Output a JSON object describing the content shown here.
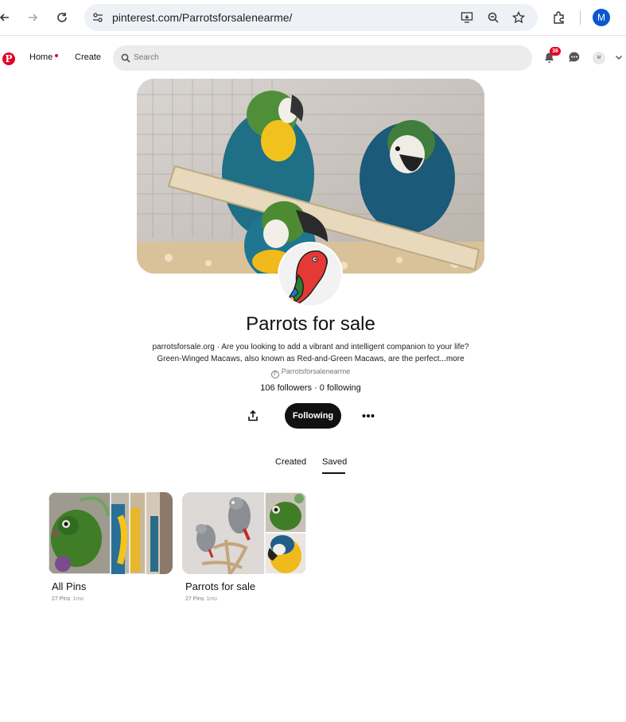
{
  "browser": {
    "url": "pinterest.com/Parrotsforsalenearme/",
    "profile_initial": "M"
  },
  "header": {
    "home_label": "Home",
    "create_label": "Create",
    "search_placeholder": "Search",
    "notification_count": "36",
    "user_initial": "M",
    "brand_color": "#e60023"
  },
  "profile": {
    "name": "Parrots for sale",
    "bio_line1": "parrotsforsale.org · Are you looking to add a vibrant and intelligent companion to your life?",
    "bio_line2": "Green-Winged Macaws, also known as Red-and-Green Macaws, are the perfect",
    "bio_more": "...more",
    "handle": "Parrotsforsalenearme",
    "stats": "106 followers · 0 following",
    "follow_button": "Following"
  },
  "tabs": [
    {
      "label": "Created",
      "active": false
    },
    {
      "label": "Saved",
      "active": true
    }
  ],
  "boards": [
    {
      "title": "All Pins",
      "pins": "27 Pins",
      "updated": "1mo"
    },
    {
      "title": "Parrots for sale",
      "pins": "27 Pins",
      "updated": "1mo"
    }
  ]
}
